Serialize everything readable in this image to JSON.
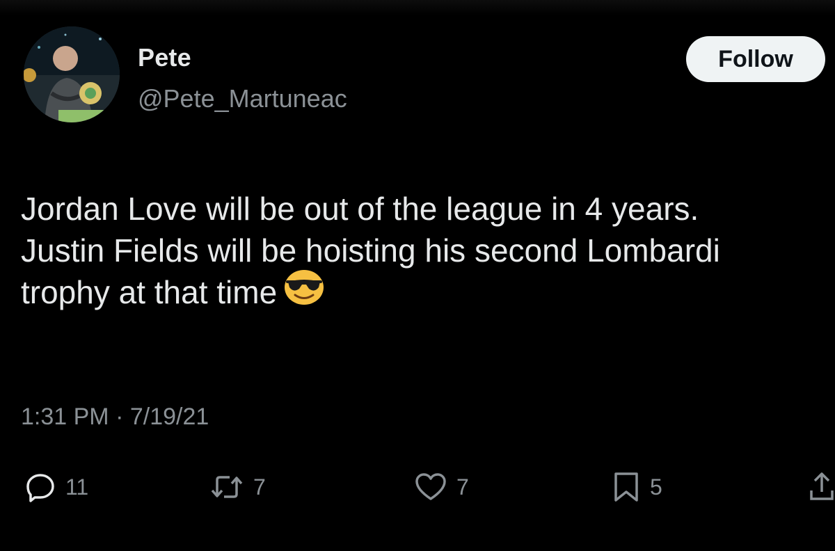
{
  "user": {
    "display_name": "Pete",
    "handle": "@Pete_Martuneac"
  },
  "follow_button": {
    "label": "Follow"
  },
  "tweet": {
    "lines": [
      "Jordan Love will be out of the league in 4 years.",
      "Justin Fields will be hoisting his second Lombardi",
      "trophy at that time"
    ],
    "emoji": "smiling-face-with-sunglasses"
  },
  "meta": {
    "time": "1:31 PM",
    "separator": "·",
    "date": "7/19/21"
  },
  "actions": {
    "replies": "11",
    "retweets": "7",
    "likes": "7",
    "bookmarks": "5"
  },
  "colors": {
    "background": "#000000",
    "text": "#e7e9ea",
    "secondary_text": "#8b9196",
    "follow_bg": "#eff3f4"
  }
}
